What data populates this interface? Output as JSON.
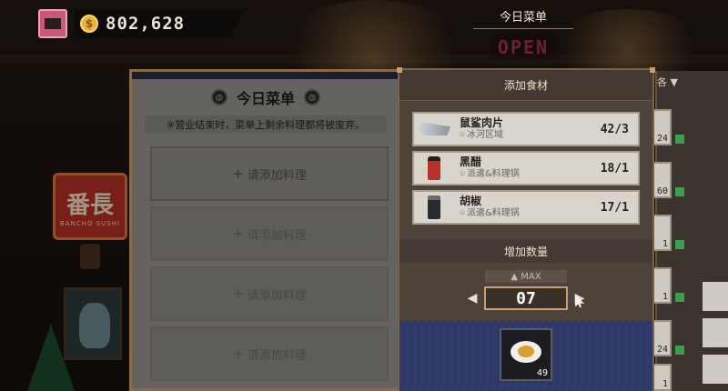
{
  "hud": {
    "coins": "802,628",
    "coin_icon": "$",
    "menu_title": "今日菜单",
    "open_sign": "OPEN"
  },
  "scene": {
    "shop_sign_main": "番長",
    "shop_sign_sub": "BANCHO SUSHI"
  },
  "menu": {
    "heading": "今日菜单",
    "notice": "※营业结束时，菜单上剩余料理都将被废弃。",
    "empty_slot_label": "请添加料理",
    "plus": "+",
    "slots": [
      "请添加料理",
      "请添加料理",
      "请添加料理",
      "请添加料理"
    ]
  },
  "ingredients": {
    "header": "添加食材",
    "items": [
      {
        "name": "鼠鲨肉片",
        "location": "冰河区域",
        "count": "42/3"
      },
      {
        "name": "黑醋",
        "location": "派遣&料理锅",
        "count": "18/1"
      },
      {
        "name": "胡椒",
        "location": "派遣&料理锅",
        "count": "17/1"
      }
    ],
    "qty_header": "增加数量",
    "max_label": "▲ MAX",
    "quantity": "07",
    "dish_count": "49"
  },
  "right_panel": {
    "tab_label": "各 ▼",
    "counts": [
      "24",
      "60",
      "1",
      "1",
      "24",
      "1"
    ]
  },
  "colors": {
    "panel_border": "#8c6a48",
    "menu_topbar": "#3a3f6a",
    "dish_bg": "#2e3868",
    "qty_border": "#c8a070"
  }
}
